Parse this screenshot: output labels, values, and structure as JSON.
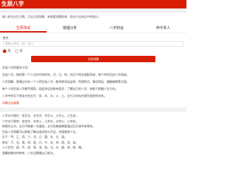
{
  "header": {
    "title": "生辰八字"
  },
  "notice": "输入姓名出生日期，点击立即测算，来查看测算结果，现在行业各运中的指示。",
  "tabs": [
    {
      "label": "生辰测试",
      "active": true
    },
    {
      "label": "婚姻分析",
      "active": false
    },
    {
      "label": "八字财运",
      "active": false
    },
    {
      "label": "命中贵人",
      "active": false
    }
  ],
  "form": {
    "name_label": "姓名",
    "name_placeholder": "请输入姓名（如：张三）",
    "gender_male": "男",
    "gender_female": "女",
    "submit_label": "立即测算"
  },
  "article": {
    "paras": [
      "生辰八字，指的是一个人出生时间的年、月、日、时，由天干地支相配而成，每个时间点由二字组成。",
      "八字测算，是通过分析一个人的生辰八字，推测其命运走势、性格特点、事业财运、婚姻感情等方面。",
      "每个人的生辰八字都不相同，因此命运也各有差异，了解自己的八字，有助于把握人生方向。",
      "八字中的天干地支对应五行：金、木、水、火、土，五行之间存在相生相克的关系。"
    ],
    "section_title": "生辰八字的基本介绍：",
    "ref_text": "详情点击查看"
  },
  "bottom": {
    "lines": [
      "八字五行相生：金生水、水生木、木生火、火生土、土生金。",
      "八字五行相克：金克木、木克土、土克水、水克火、火克金。",
      "命理学认为，五行平衡者一生顺遂，五行失衡者需要通过后天调节来弥补。",
      "生辰八字测算可以帮助了解自身优势与不足，合理规划人生。",
      "天干：甲、乙、丙、丁、戊、己、庚、辛、壬、癸。",
      "地支：子、丑、寅、卯、辰、巳、午、未、申、酉、戌、亥。",
      "十二生肖：鼠、牛、虎、兔、龙、蛇、马、羊、猴、鸡、狗、猪。",
      "测算结果仅供参考，人生还需靠自己努力。"
    ]
  }
}
